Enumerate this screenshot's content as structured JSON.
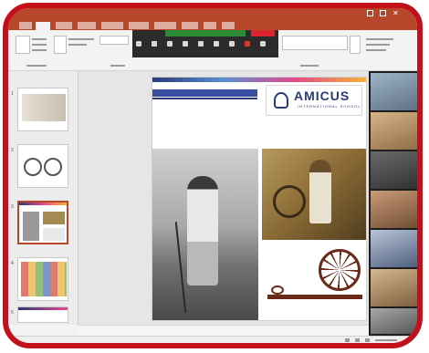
{
  "app": {
    "window_title": ""
  },
  "ribbon": {
    "tabs": [
      "",
      "",
      "",
      "",
      "",
      "",
      "",
      "",
      "",
      ""
    ],
    "active_tab": 1
  },
  "meeting_toolbar": {
    "banner": "",
    "stop_label": ""
  },
  "thumbnails": [
    {
      "number": "1"
    },
    {
      "number": "2"
    },
    {
      "number": "3"
    },
    {
      "number": "4"
    },
    {
      "number": "5"
    }
  ],
  "slide": {
    "title_bar": "",
    "school_name": "AMICUS",
    "school_sub": "INTERNATIONAL SCHOOL",
    "tagline": "",
    "address": "",
    "contact": "",
    "affiliation": ""
  },
  "notes": {
    "placeholder": ""
  },
  "participants": [
    {
      "name": ""
    },
    {
      "name": ""
    },
    {
      "name": ""
    },
    {
      "name": ""
    },
    {
      "name": ""
    },
    {
      "name": ""
    },
    {
      "name": ""
    }
  ],
  "status": {
    "left": "",
    "right": ""
  },
  "taskbar": {
    "time": "",
    "date": ""
  },
  "colors": {
    "accent": "#b7472a",
    "frame": "#c4101a",
    "meeting_green": "#2e8b35",
    "stop_red": "#d9252b",
    "school_blue": "#2b3a7a"
  }
}
